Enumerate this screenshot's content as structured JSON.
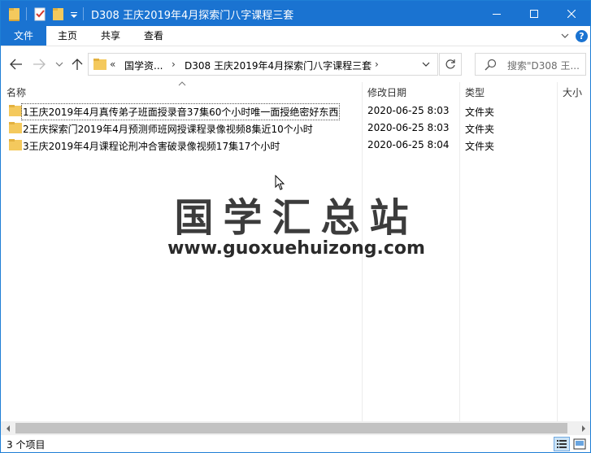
{
  "window": {
    "title": "D308 王庆2019年4月探索门八字课程三套"
  },
  "ribbon": {
    "tabs": {
      "file": "文件",
      "home": "主页",
      "share": "共享",
      "view": "查看"
    },
    "help_label": "?"
  },
  "address": {
    "overflow": "«",
    "segments": [
      "国学资...",
      "D308 王庆2019年4月探索门八字课程三套"
    ],
    "separator": "›"
  },
  "search": {
    "placeholder": "搜索\"D308 王..."
  },
  "columns": {
    "name": "名称",
    "date": "修改日期",
    "type": "类型",
    "size": "大小"
  },
  "files": [
    {
      "name": "1王庆2019年4月真传弟子班面授录音37集60个小时唯一面授绝密好东西",
      "date": "2020-06-25 8:03",
      "type": "文件夹"
    },
    {
      "name": "2王庆探索门2019年4月预测师班网授课程录像视频8集近10个小时",
      "date": "2020-06-25 8:03",
      "type": "文件夹"
    },
    {
      "name": "3王庆2019年4月课程论刑冲合害破录像视频17集17个小时",
      "date": "2020-06-25 8:04",
      "type": "文件夹"
    }
  ],
  "watermark": {
    "chinese": "国学汇总站",
    "url": "www.guoxuehuizong.com"
  },
  "status": {
    "item_count": "3 个项目"
  },
  "colors": {
    "accent": "#1a73d1",
    "folder": "#f4c95d"
  }
}
